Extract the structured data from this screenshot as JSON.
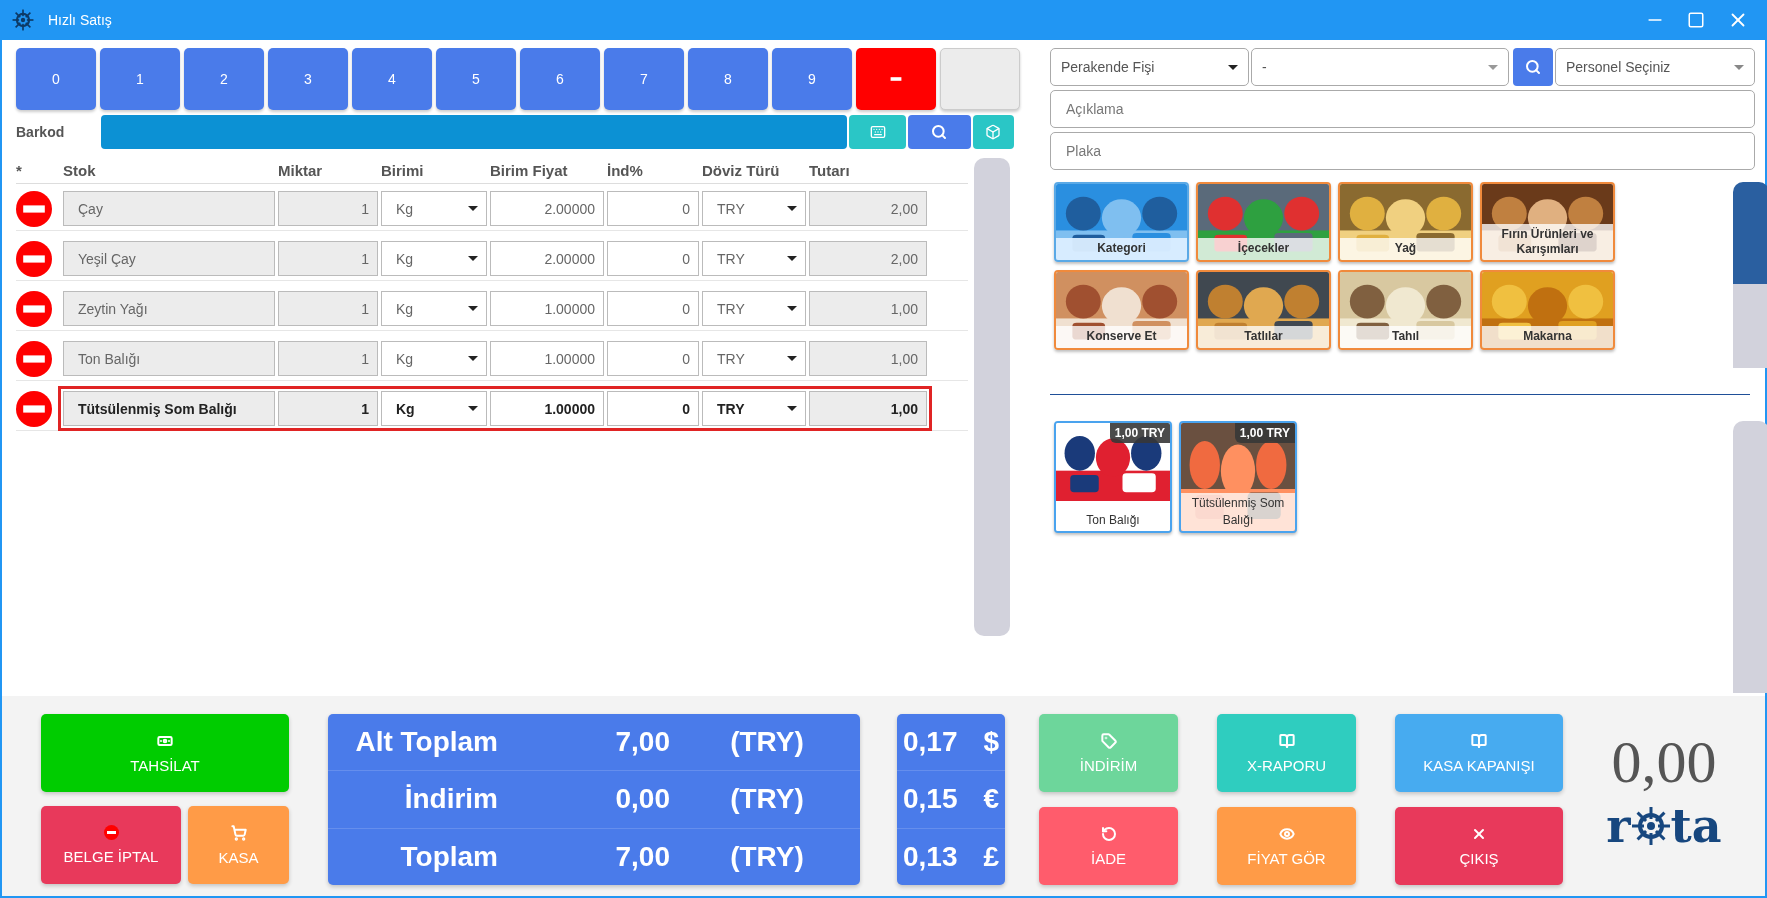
{
  "window": {
    "title": "Hızlı Satış"
  },
  "keypad": {
    "keys": [
      "0",
      "1",
      "2",
      "3",
      "4",
      "5",
      "6",
      "7",
      "8",
      "9"
    ]
  },
  "barcode": {
    "label": "Barkod"
  },
  "table": {
    "columns": [
      "*",
      "Stok",
      "Miktar",
      "Birimi",
      "Birim Fiyat",
      "İnd%",
      "Döviz Türü",
      "Tutarı"
    ],
    "rows": [
      {
        "stock": "Çay",
        "quantity": "1",
        "unit": "Kg",
        "unit_price": "2.00000",
        "discount": "0",
        "currency": "TRY",
        "total": "2,00",
        "selected": false
      },
      {
        "stock": "Yeşil Çay",
        "quantity": "1",
        "unit": "Kg",
        "unit_price": "2.00000",
        "discount": "0",
        "currency": "TRY",
        "total": "2,00",
        "selected": false
      },
      {
        "stock": "Zeytin Yağı",
        "quantity": "1",
        "unit": "Kg",
        "unit_price": "1.00000",
        "discount": "0",
        "currency": "TRY",
        "total": "1,00",
        "selected": false
      },
      {
        "stock": "Ton Balığı",
        "quantity": "1",
        "unit": "Kg",
        "unit_price": "1.00000",
        "discount": "0",
        "currency": "TRY",
        "total": "1,00",
        "selected": false
      },
      {
        "stock": "Tütsülenmiş Som Balığı",
        "quantity": "1",
        "unit": "Kg",
        "unit_price": "1.00000",
        "discount": "0",
        "currency": "TRY",
        "total": "1,00",
        "selected": true
      }
    ]
  },
  "receipt": {
    "type": "Perakende Fişi",
    "customer": "-",
    "staff": "Personel Seçiniz",
    "description_placeholder": "Açıklama",
    "plate_placeholder": "Plaka"
  },
  "categories": [
    {
      "label": "Kategori",
      "selected": true
    },
    {
      "label": "İçecekler",
      "selected": false
    },
    {
      "label": "Yağ",
      "selected": false
    },
    {
      "label": "Fırın Ürünleri ve Karışımları",
      "selected": false
    },
    {
      "label": "Konserve Et",
      "selected": false
    },
    {
      "label": "Tatlılar",
      "selected": false
    },
    {
      "label": "Tahıl",
      "selected": false
    },
    {
      "label": "Makarna",
      "selected": false
    }
  ],
  "products": [
    {
      "name": "Ton Balığı",
      "price": "1,00 TRY"
    },
    {
      "name": "Tütsülenmiş Som Balığı",
      "price": "1,00 TRY"
    }
  ],
  "payment_buttons": [
    {
      "label": "TAHSİLAT",
      "kind": "money",
      "color": "#00cc00"
    },
    {
      "label": "BELGE İPTAL",
      "kind": "minus",
      "color": "#e8395b"
    },
    {
      "label": "KASA",
      "kind": "cart",
      "color": "#ff9b47"
    }
  ],
  "summary": {
    "rows": [
      {
        "label": "Alt Toplam",
        "amount": "7,00",
        "currency": "(TRY)"
      },
      {
        "label": "İndirim",
        "amount": "0,00",
        "currency": "(TRY)"
      },
      {
        "label": "Toplam",
        "amount": "7,00",
        "currency": "(TRY)"
      }
    ],
    "foreign": [
      {
        "amount": "0,17",
        "symbol": "$"
      },
      {
        "amount": "0,15",
        "symbol": "€"
      },
      {
        "amount": "0,13",
        "symbol": "£"
      }
    ]
  },
  "action_buttons": [
    {
      "label": "İNDİRİM",
      "kind": "tag",
      "color": "#6dd69b"
    },
    {
      "label": "X-RAPORU",
      "kind": "book",
      "color": "#2fcdbf"
    },
    {
      "label": "KASA KAPANIŞI",
      "kind": "book",
      "color": "#47abf0"
    },
    {
      "label": "İADE",
      "kind": "undo",
      "color": "#ff5c6c"
    },
    {
      "label": "FİYAT GÖR",
      "kind": "eye",
      "color": "#ff9b47"
    },
    {
      "label": "ÇIKIŞ",
      "kind": "close",
      "color": "#e8395b"
    }
  ],
  "display": {
    "amount": "0,00"
  },
  "logo": {
    "left": "r",
    "right": "ta"
  }
}
